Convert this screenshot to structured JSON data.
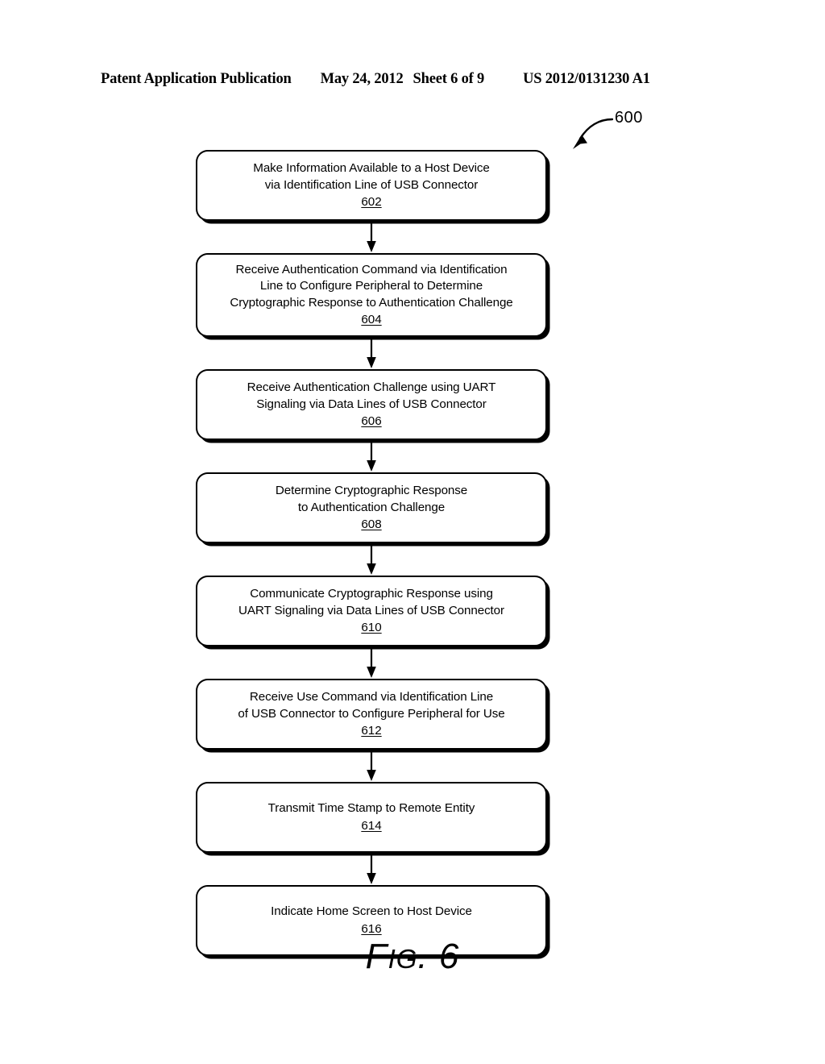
{
  "header": {
    "publication": "Patent Application Publication",
    "date": "May 24, 2012",
    "sheet": "Sheet 6 of 9",
    "patent_number": "US 2012/0131230 A1"
  },
  "figure": {
    "reference_label": "600",
    "caption_lead": "F",
    "caption_small": "IG",
    "caption_tail": ". 6",
    "caption_full": "FIG. 6"
  },
  "flowchart": {
    "steps": [
      {
        "text": "Make Information Available to a Host Device\nvia Identification Line of USB Connector",
        "ref": "602"
      },
      {
        "text": "Receive Authentication Command via Identification\nLine to Configure Peripheral to Determine\nCryptographic Response to Authentication Challenge",
        "ref": "604"
      },
      {
        "text": "Receive Authentication Challenge using UART\nSignaling via Data Lines of USB Connector",
        "ref": "606"
      },
      {
        "text": "Determine Cryptographic Response\nto Authentication Challenge",
        "ref": "608"
      },
      {
        "text": "Communicate Cryptographic Response using\nUART Signaling via Data Lines of USB Connector",
        "ref": "610"
      },
      {
        "text": "Receive Use Command via Identification Line\nof USB Connector to Configure Peripheral for Use",
        "ref": "612"
      },
      {
        "text": "Transmit Time Stamp to Remote Entity",
        "ref": "614"
      },
      {
        "text": "Indicate Home Screen to Host Device",
        "ref": "616"
      }
    ]
  },
  "colors": {
    "ink": "#000000",
    "page": "#ffffff"
  }
}
